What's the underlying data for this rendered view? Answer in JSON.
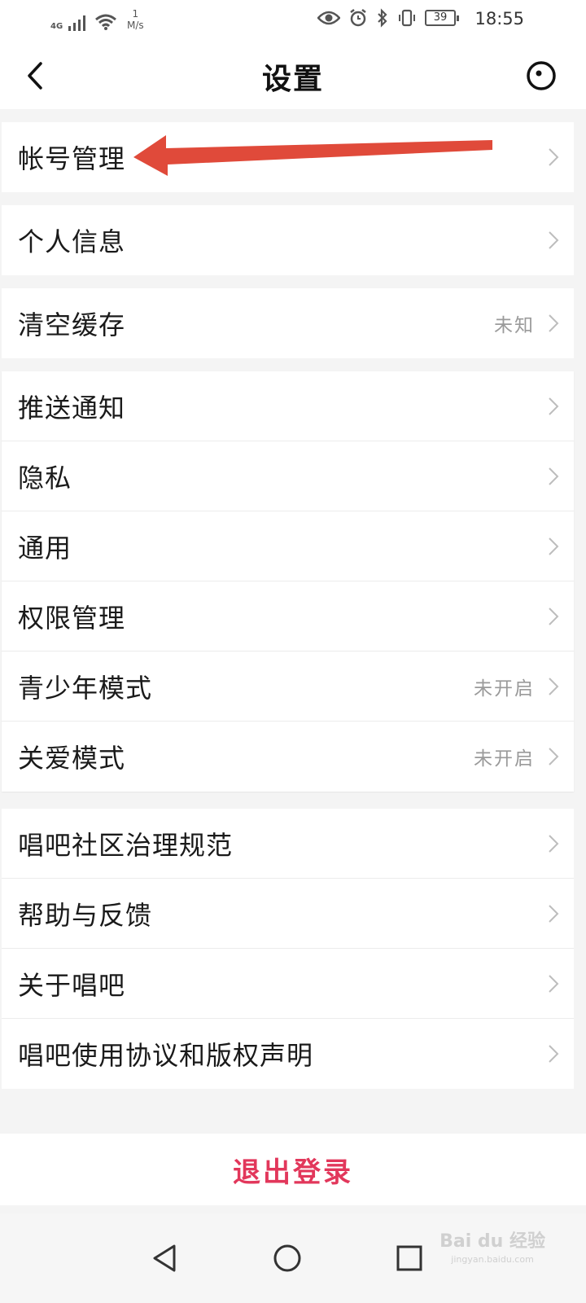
{
  "status_bar": {
    "network": "4G",
    "speed_value": "1",
    "speed_unit": "M/s",
    "battery": "39",
    "time": "18:55"
  },
  "header": {
    "title": "设置",
    "back_icon": "chevron-left-icon",
    "more_icon": "circle-dot-icon"
  },
  "groups": [
    {
      "items": [
        {
          "label": "帐号管理",
          "value": ""
        }
      ]
    },
    {
      "items": [
        {
          "label": "个人信息",
          "value": ""
        }
      ]
    },
    {
      "items": [
        {
          "label": "清空缓存",
          "value": "未知"
        }
      ]
    },
    {
      "items": [
        {
          "label": "推送通知",
          "value": ""
        },
        {
          "label": "隐私",
          "value": ""
        },
        {
          "label": "通用",
          "value": ""
        },
        {
          "label": "权限管理",
          "value": ""
        },
        {
          "label": "青少年模式",
          "value": "未开启"
        },
        {
          "label": "关爱模式",
          "value": "未开启"
        }
      ]
    },
    {
      "items": [
        {
          "label": "唱吧社区治理规范",
          "value": ""
        },
        {
          "label": "帮助与反馈",
          "value": ""
        },
        {
          "label": "关于唱吧",
          "value": ""
        },
        {
          "label": "唱吧使用协议和版权声明",
          "value": ""
        }
      ]
    }
  ],
  "logout": {
    "label": "退出登录",
    "color": "#e2375b"
  },
  "annotation": {
    "arrow_color": "#e04a3a"
  },
  "watermark": {
    "brand": "Bai du 经验",
    "url": "jingyan.baidu.com"
  },
  "nav": {
    "back": "triangle-back-icon",
    "home": "circle-home-icon",
    "recents": "square-recents-icon"
  }
}
